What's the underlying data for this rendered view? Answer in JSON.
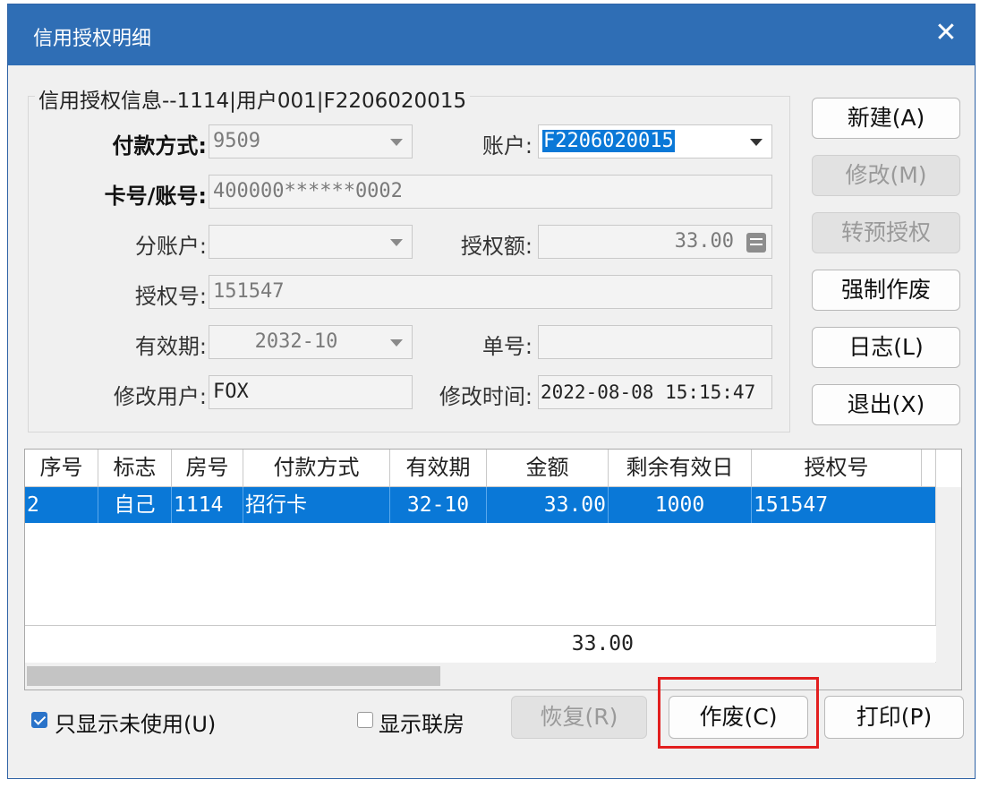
{
  "window": {
    "title": "信用授权明细",
    "close_glyph": "✕"
  },
  "info": {
    "legend": "信用授权信息--1114|用户001|F2206020015",
    "payment_method_label": "付款方式:",
    "payment_method_value": "9509",
    "account_label": "账户:",
    "account_value": "F2206020015",
    "card_label": "卡号/账号:",
    "card_value": "400000******0002",
    "sub_account_label": "分账户:",
    "sub_account_value": "",
    "auth_amount_label": "授权额:",
    "auth_amount_value": "33.00",
    "auth_no_label": "授权号:",
    "auth_no_value": "151547",
    "expiry_label": "有效期:",
    "expiry_value": "2032-10",
    "order_no_label": "单号:",
    "order_no_value": "",
    "modify_user_label": "修改用户:",
    "modify_user_value": "FOX",
    "modify_time_label": "修改时间:",
    "modify_time_value": "2022-08-08 15:15:47"
  },
  "side_buttons": {
    "new": "新建(A)",
    "edit": "修改(M)",
    "pre_auth": "转预授权",
    "force_void": "强制作废",
    "log": "日志(L)",
    "exit": "退出(X)"
  },
  "grid": {
    "headers": [
      "序号",
      "标志",
      "房号",
      "付款方式",
      "有效期",
      "金额",
      "剩余有效日",
      "授权号"
    ],
    "rows": [
      {
        "seq": "2",
        "flag": "自己",
        "room": "1114",
        "method": "招行卡",
        "expiry": "32-10",
        "amount": "33.00",
        "days_left": "1000",
        "auth_no": "151547"
      }
    ],
    "total": "33.00"
  },
  "bottom": {
    "only_unused_label": "只显示未使用(U)",
    "only_unused_checked": true,
    "show_linked_label": "显示联房",
    "show_linked_checked": false,
    "restore": "恢复(R)",
    "void": "作废(C)",
    "print": "打印(P)"
  },
  "colors": {
    "titlebar": "#2f6eb5",
    "selection": "#0a78d7",
    "highlight_box": "#e21f1f"
  },
  "icons": [
    "close-icon",
    "dropdown-arrow-icon",
    "calculator-icon",
    "checkbox-icon"
  ]
}
